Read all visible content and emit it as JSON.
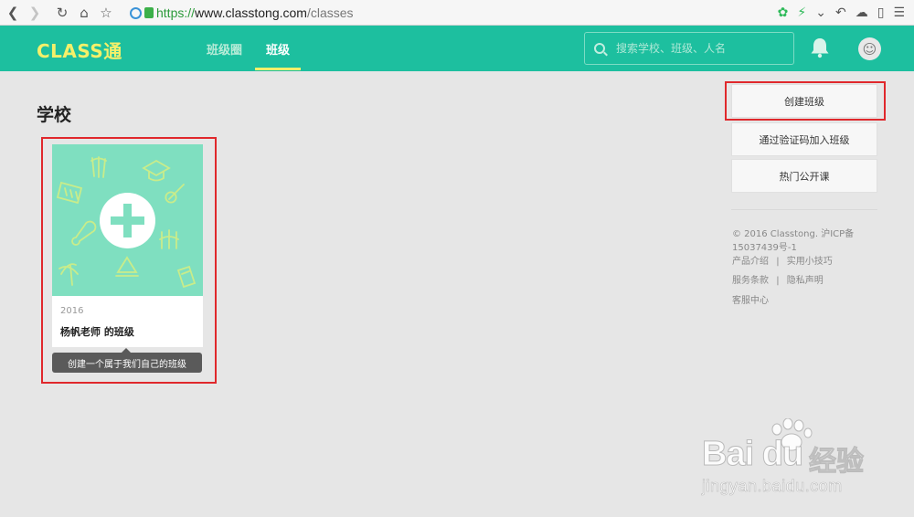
{
  "browser": {
    "url_scheme": "https://",
    "url_host": "www.classtong.com",
    "url_path": "/classes"
  },
  "header": {
    "logo": "CLASS通",
    "tabs": [
      {
        "label": "班级圈",
        "active": false
      },
      {
        "label": "班级",
        "active": true
      }
    ],
    "search_placeholder": "搜索学校、班级、人名",
    "accent_color": "#1dbf9f",
    "highlight_color": "#f4f06a"
  },
  "main": {
    "section_title": "学校",
    "class_card": {
      "year": "2016",
      "name": "杨帆老师 的班级",
      "cover_color": "#7fdfc0"
    },
    "tooltip": "创建一个属于我们自己的班级"
  },
  "sidebar": {
    "buttons": [
      {
        "label": "创建班级"
      },
      {
        "label": "通过验证码加入班级"
      },
      {
        "label": "热门公开课"
      }
    ],
    "footer": {
      "copyright": "© 2016 Classtong. 沪ICP备",
      "icp": "15037439号-1",
      "links_row1": [
        "产品介绍",
        "实用小技巧"
      ],
      "links_row2": [
        "服务条款",
        "隐私声明"
      ],
      "support": "客服中心"
    }
  },
  "watermark": {
    "brand": "Bai du",
    "brand_cn": "经验",
    "url": "jingyan.baidu.com"
  }
}
